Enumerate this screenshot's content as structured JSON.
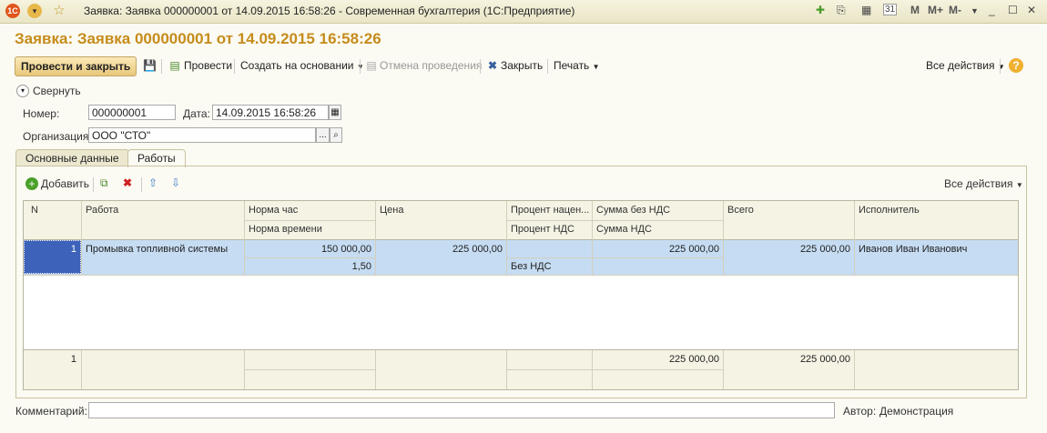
{
  "window": {
    "title": "Заявка: Заявка 000000001 от 14.09.2015 16:58:26 - Современная бухгалтерия  (1С:Предприятие)",
    "m_label": "M",
    "mplus_label": "M+",
    "mminus_label": "M-",
    "calendar_day": "31"
  },
  "document": {
    "title": "Заявка: Заявка 000000001 от 14.09.2015 16:58:26"
  },
  "toolbar": {
    "post_and_close": "Провести и закрыть",
    "post": "Провести",
    "create_based_on": "Создать на основании",
    "cancel_posting": "Отмена проведения",
    "close": "Закрыть",
    "print": "Печать",
    "all_actions": "Все действия"
  },
  "collapse_label": "Свернуть",
  "fields": {
    "number_label": "Номер:",
    "number_value": "000000001",
    "date_label": "Дата:",
    "date_value": "14.09.2015 16:58:26",
    "org_label": "Организация:",
    "org_value": "ООО \"СТО\"",
    "choose_btn": "..."
  },
  "tabs": [
    {
      "label": "Основные данные"
    },
    {
      "label": "Работы"
    }
  ],
  "grid_toolbar": {
    "add": "Добавить",
    "all_actions": "Все действия"
  },
  "table": {
    "headers": {
      "n": "N",
      "work": "Работа",
      "norm_hour": "Норма час",
      "norm_time": "Норма времени",
      "price": "Цена",
      "markup_percent": "Процент нацен...",
      "vat_percent": "Процент НДС",
      "sum_without_vat": "Сумма без НДС",
      "vat_sum": "Сумма НДС",
      "total": "Всего",
      "executor": "Исполнитель"
    },
    "rows": [
      {
        "n": "1",
        "work": "Промывка топливной системы",
        "norm_hour": "150 000,00",
        "norm_time": "1,50",
        "price": "225 000,00",
        "markup_percent": "",
        "vat_percent": "Без НДС",
        "sum_without_vat": "225 000,00",
        "vat_sum": "",
        "total": "225 000,00",
        "executor": "Иванов  Иван Иванович"
      }
    ],
    "footer": {
      "n": "1",
      "sum_without_vat": "225 000,00",
      "total": "225 000,00"
    }
  },
  "bottom": {
    "comment_label": "Комментарий:",
    "comment_value": "",
    "author_label": "Автор:",
    "author_value": "Демонстрация"
  },
  "colors": {
    "title_accent": "#c58c1b",
    "selected_row": "#c6dcf2",
    "selected_cell": "#3d62b9"
  }
}
